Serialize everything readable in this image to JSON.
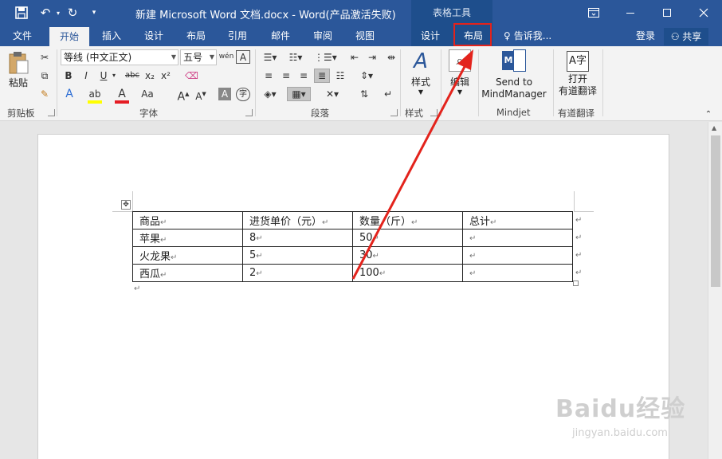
{
  "title_bar": {
    "title": "新建 Microsoft Word 文档.docx - Word(产品激活失败)",
    "context_header": "表格工具"
  },
  "tabs": [
    "文件",
    "开始",
    "插入",
    "设计",
    "布局",
    "引用",
    "邮件",
    "审阅",
    "视图"
  ],
  "context_tabs": [
    "设计",
    "布局"
  ],
  "tell_me": "告诉我...",
  "account": {
    "login": "登录",
    "share": "共享"
  },
  "ribbon": {
    "clipboard": {
      "paste": "粘贴",
      "label": "剪贴板"
    },
    "font": {
      "name": "等线 (中文正文)",
      "size": "五号",
      "label": "字体"
    },
    "paragraph": {
      "label": "段落"
    },
    "styles": {
      "button": "样式",
      "label": "样式"
    },
    "editing": {
      "button": "编辑"
    },
    "mindjet": {
      "line1": "Send to",
      "line2": "MindManager",
      "label": "Mindjet"
    },
    "youdao": {
      "line1": "打开",
      "line2": "有道翻译",
      "label": "有道翻译"
    }
  },
  "table": {
    "rows": [
      [
        "商品",
        "进货单价（元）",
        "数量（斤）",
        "总计"
      ],
      [
        "苹果",
        "8",
        "50",
        ""
      ],
      [
        "火龙果",
        "5",
        "30",
        ""
      ],
      [
        "西瓜",
        "2",
        "100",
        ""
      ]
    ]
  },
  "watermark": {
    "brand": "Baidu经验",
    "url": "jingyan.baidu.com"
  },
  "colors": {
    "accent": "#2b579a",
    "highlight": "#e3231c"
  }
}
